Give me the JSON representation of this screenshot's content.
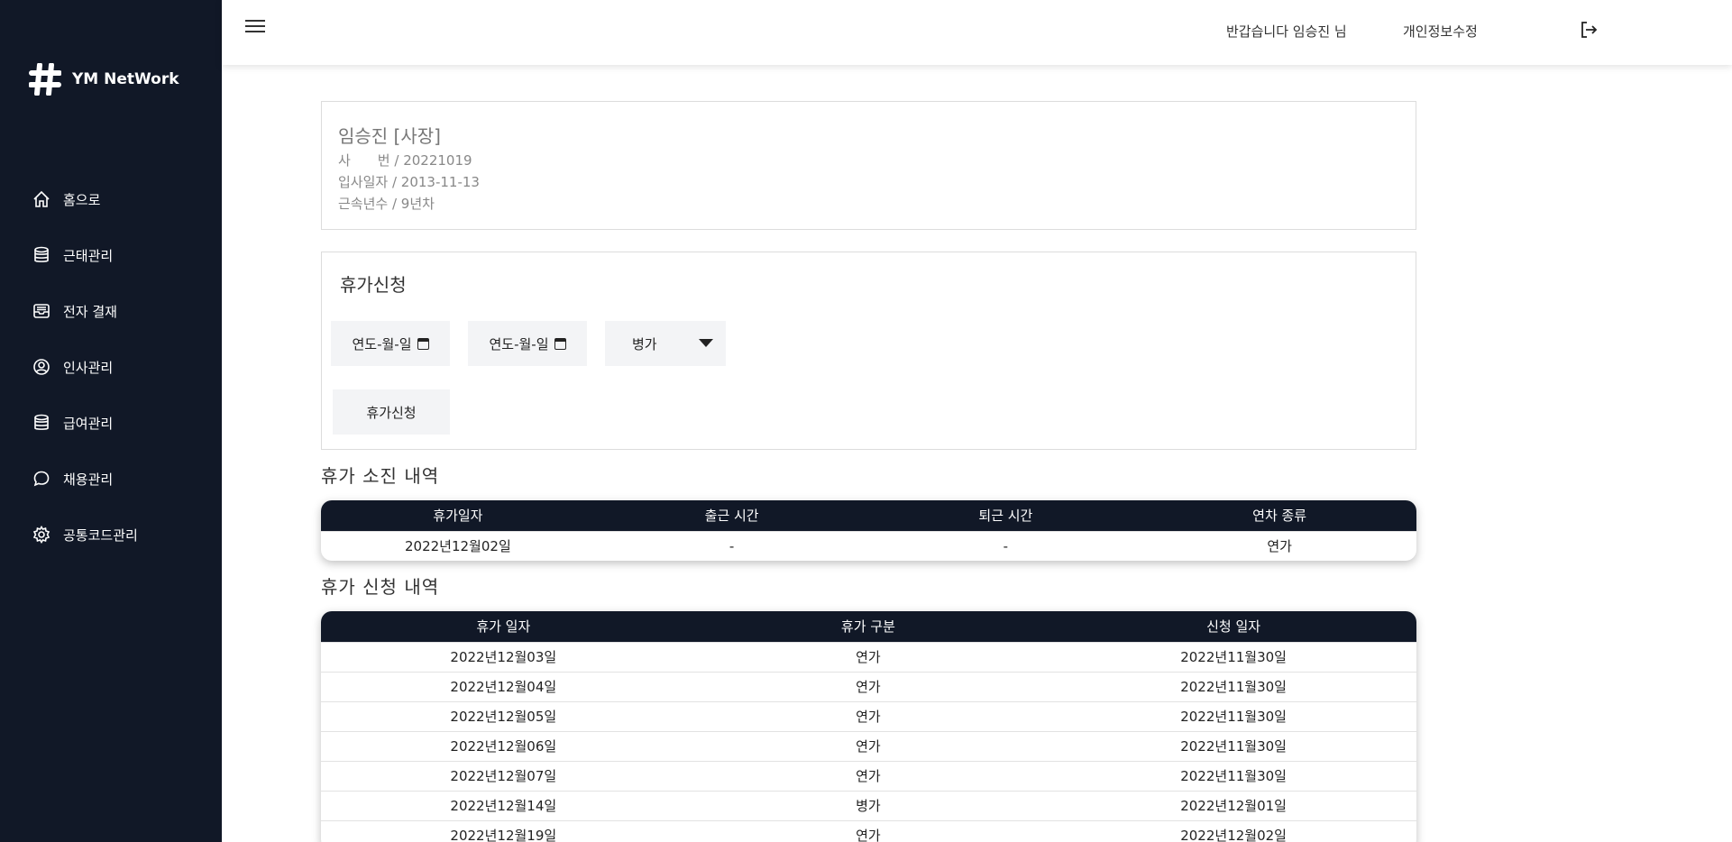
{
  "brand": {
    "name": "YM NetWork"
  },
  "sidebar": {
    "items": [
      {
        "label": "홈으로",
        "icon": "home-icon"
      },
      {
        "label": "근태관리",
        "icon": "database-icon"
      },
      {
        "label": "전자 결재",
        "icon": "inbox-icon"
      },
      {
        "label": "인사관리",
        "icon": "user-circle-icon"
      },
      {
        "label": "급여관리",
        "icon": "database-icon"
      },
      {
        "label": "채용관리",
        "icon": "chat-icon"
      },
      {
        "label": "공통코드관리",
        "icon": "gear-icon"
      }
    ]
  },
  "header": {
    "greeting": "반갑습니다 임승진 님",
    "edit_profile": "개인정보수정"
  },
  "profile": {
    "name": "임승진 [사장]",
    "employee_no": "사　　번 / 20221019",
    "hire_date": "입사일자 / 2013-11-13",
    "years": "근속년수 / 9년차"
  },
  "leave_request": {
    "title": "휴가신청",
    "start_placeholder": "연도-월-일",
    "end_placeholder": "연도-월-일",
    "type_selected": "병가",
    "submit_label": "휴가신청"
  },
  "usage": {
    "title": "휴가 소진 내역",
    "columns": [
      "휴가일자",
      "출근 시간",
      "퇴근 시간",
      "연차 종류"
    ],
    "rows": [
      [
        "2022년12월02일",
        "-",
        "-",
        "연가"
      ]
    ]
  },
  "history": {
    "title": "휴가 신청 내역",
    "columns": [
      "휴가 일자",
      "휴가 구분",
      "신청 일자"
    ],
    "rows": [
      [
        "2022년12월03일",
        "연가",
        "2022년11월30일"
      ],
      [
        "2022년12월04일",
        "연가",
        "2022년11월30일"
      ],
      [
        "2022년12월05일",
        "연가",
        "2022년11월30일"
      ],
      [
        "2022년12월06일",
        "연가",
        "2022년11월30일"
      ],
      [
        "2022년12월07일",
        "연가",
        "2022년11월30일"
      ],
      [
        "2022년12월14일",
        "병가",
        "2022년12월01일"
      ],
      [
        "2022년12월19일",
        "연가",
        "2022년12월02일"
      ]
    ]
  },
  "colors": {
    "sidebar_bg": "#111827",
    "header_row_bg": "#111827",
    "input_bg": "#f3f4f6"
  }
}
